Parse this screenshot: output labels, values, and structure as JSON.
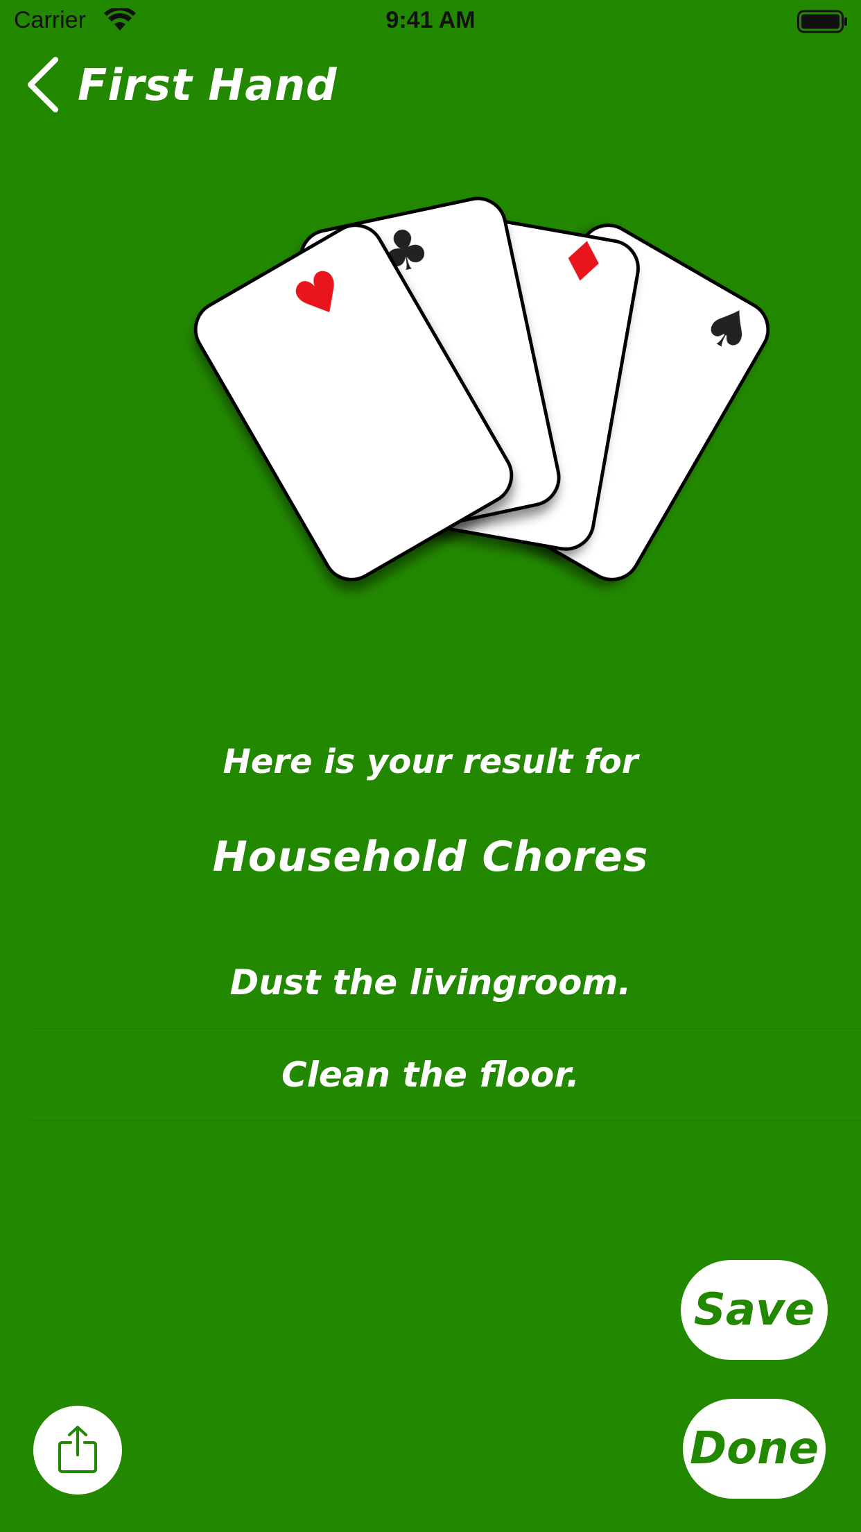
{
  "status_bar": {
    "carrier": "Carrier",
    "time": "9:41 AM",
    "wifi_icon": "wifi-icon",
    "battery_icon": "battery-icon"
  },
  "nav": {
    "back_icon": "chevron-left-icon",
    "title": "First Hand"
  },
  "illustration": {
    "cards": [
      {
        "suit": "heart",
        "symbol": "♥",
        "color": "#e8161b"
      },
      {
        "suit": "club",
        "symbol": "♣",
        "color": "#222222"
      },
      {
        "suit": "diamond",
        "symbol": "♦",
        "color": "#e8161b"
      },
      {
        "suit": "spade",
        "symbol": "♠",
        "color": "#222222"
      }
    ]
  },
  "result": {
    "intro": "Here is your result for",
    "category": "Household Chores",
    "items": [
      "Dust the livingroom.",
      "Clean the floor."
    ]
  },
  "buttons": {
    "save_label": "Save",
    "done_label": "Done",
    "share_icon": "share-icon"
  },
  "colors": {
    "background": "#228800",
    "text": "#ffffff",
    "button_bg": "#ffffff",
    "button_text": "#228800"
  }
}
